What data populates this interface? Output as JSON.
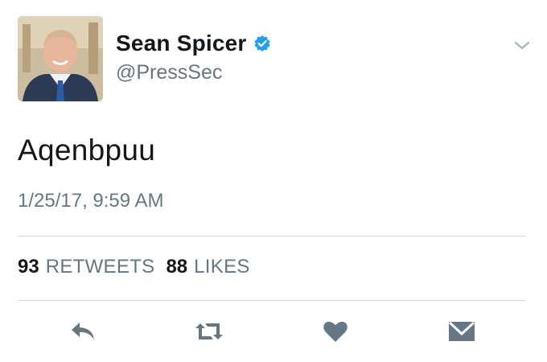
{
  "user": {
    "display_name": "Sean Spicer",
    "handle": "@PressSec",
    "verified": true
  },
  "tweet": {
    "text": "Aqenbpuu",
    "timestamp": "1/25/17, 9:59 AM"
  },
  "stats": {
    "retweets_count": "93",
    "retweets_label": "RETWEETS",
    "likes_count": "88",
    "likes_label": "LIKES"
  },
  "actions": {
    "icons": [
      "reply-icon",
      "retweet-icon",
      "like-icon",
      "direct-message-icon"
    ]
  },
  "colors": {
    "text_primary": "#14171a",
    "text_secondary": "#657786",
    "icon": "#657786",
    "verified_badge": "#1da1f2",
    "divider": "#d8dde2",
    "background": "#ffffff"
  }
}
